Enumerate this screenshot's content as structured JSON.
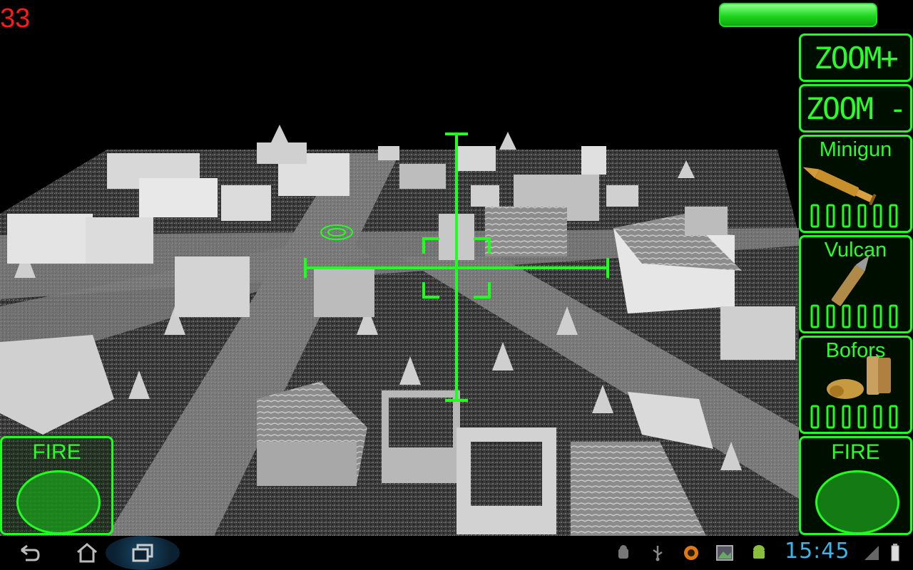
{
  "hud": {
    "fps_counter": "33",
    "health_level": 1.0
  },
  "zoom_controls": {
    "zoom_in_label": "ZOOM+",
    "zoom_out_label": "ZOOM -"
  },
  "weapons": [
    {
      "name": "Minigun",
      "icon": "rifle-bullet-icon",
      "ammo_bars": 6
    },
    {
      "name": "Vulcan",
      "icon": "cannon-shell-icon",
      "ammo_bars": 6
    },
    {
      "name": "Bofors",
      "icon": "bofors-shells-icon",
      "ammo_bars": 6
    }
  ],
  "fire_left": {
    "label": "FIRE"
  },
  "fire_right": {
    "label": "FIRE"
  },
  "navbar": {
    "buttons": [
      "back-icon",
      "home-icon",
      "recent-apps-icon"
    ],
    "status_icons": [
      "android-debug-icon",
      "usb-icon",
      "notification-icon",
      "gallery-icon",
      "android-icon"
    ],
    "time": "15:45"
  },
  "colors": {
    "hud_green": "#21ff21",
    "fps_red": "#ff1a1a",
    "clock_blue": "#3ab7ea"
  }
}
